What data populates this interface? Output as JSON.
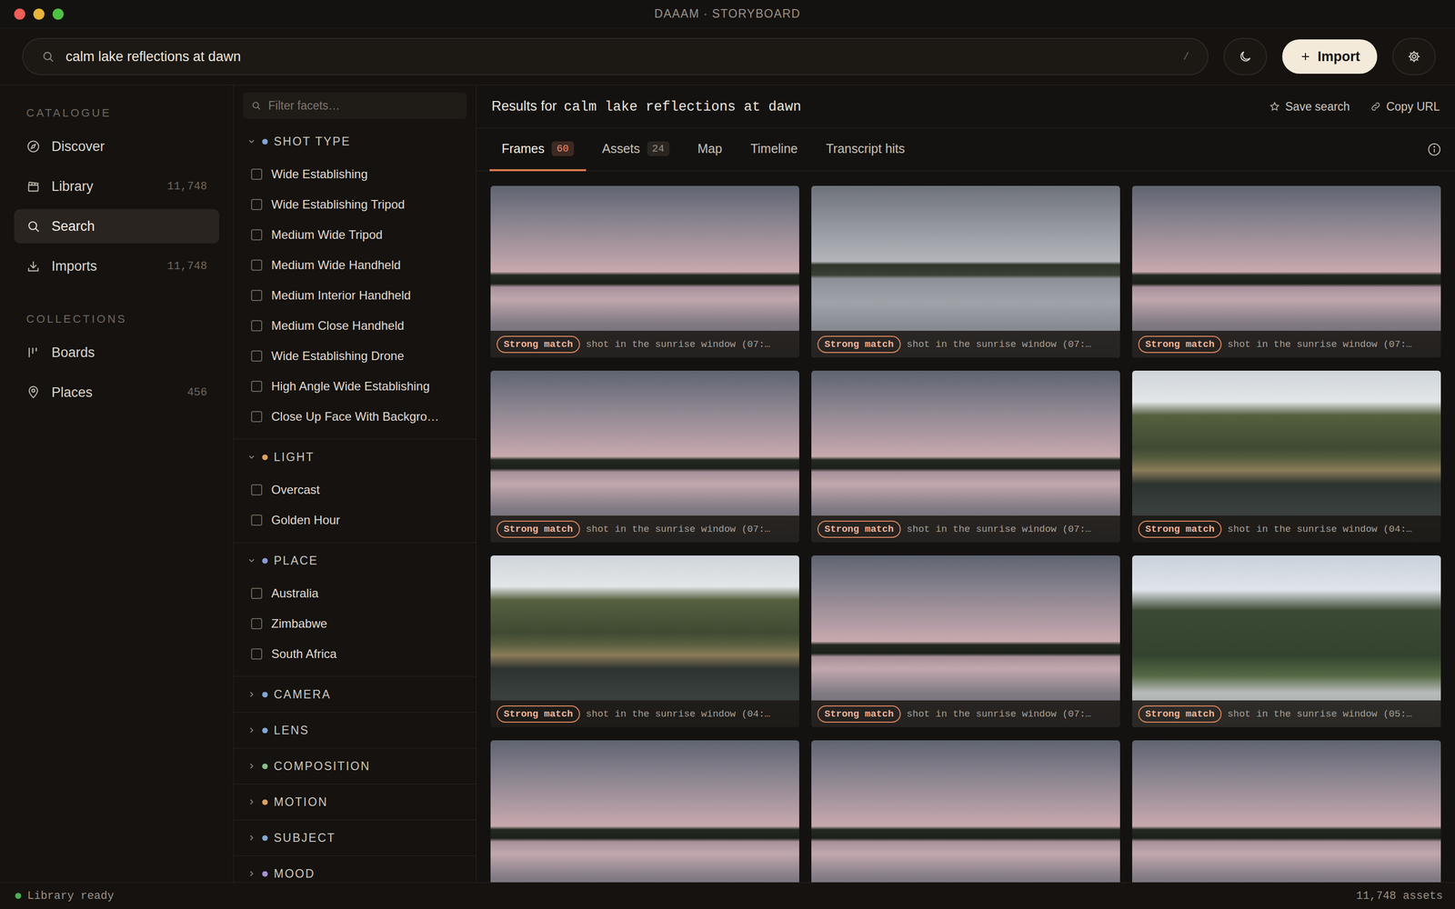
{
  "window": {
    "title": "DAAAM · STORYBOARD"
  },
  "search": {
    "value": "calm lake reflections at dawn",
    "shortcut": "/"
  },
  "toolbar": {
    "import": "Import"
  },
  "sidebar": {
    "sections": [
      {
        "label": "CATALOGUE",
        "items": [
          {
            "label": "Discover",
            "count": null,
            "selected": false
          },
          {
            "label": "Library",
            "count": "11,748",
            "selected": false
          },
          {
            "label": "Search",
            "count": null,
            "selected": true
          },
          {
            "label": "Imports",
            "count": "11,748",
            "selected": false
          }
        ]
      },
      {
        "label": "COLLECTIONS",
        "items": [
          {
            "label": "Boards",
            "count": null,
            "selected": false
          },
          {
            "label": "Places",
            "count": "456",
            "selected": false
          }
        ]
      }
    ]
  },
  "facets": {
    "filter_placeholder": "Filter facets…",
    "groups": [
      {
        "label": "SHOT TYPE",
        "color": "#7fa7d9",
        "expanded": true,
        "options": [
          {
            "label": "Wide Establishing",
            "checked": false
          },
          {
            "label": "Wide Establishing Tripod",
            "checked": false
          },
          {
            "label": "Medium Wide Tripod",
            "checked": false
          },
          {
            "label": "Medium Wide Handheld",
            "checked": false
          },
          {
            "label": "Medium Interior Handheld",
            "checked": false
          },
          {
            "label": "Medium Close Handheld",
            "checked": false
          },
          {
            "label": "Wide Establishing Drone",
            "checked": false
          },
          {
            "label": "High Angle Wide Establishing",
            "checked": false
          },
          {
            "label": "Close Up Face With Backgro…",
            "checked": false
          }
        ]
      },
      {
        "label": "LIGHT",
        "color": "#e0a060",
        "expanded": true,
        "options": [
          {
            "label": "Overcast",
            "checked": false
          },
          {
            "label": "Golden Hour",
            "checked": false
          }
        ]
      },
      {
        "label": "PLACE",
        "color": "#8a9ad8",
        "expanded": true,
        "options": [
          {
            "label": "Australia",
            "checked": false
          },
          {
            "label": "Zimbabwe",
            "checked": false
          },
          {
            "label": "South Africa",
            "checked": false
          }
        ]
      },
      {
        "label": "CAMERA",
        "color": "#7fa7d9",
        "expanded": false,
        "options": []
      },
      {
        "label": "LENS",
        "color": "#7fa7d9",
        "expanded": false,
        "options": []
      },
      {
        "label": "COMPOSITION",
        "color": "#86c08a",
        "expanded": false,
        "options": []
      },
      {
        "label": "MOTION",
        "color": "#e0a060",
        "expanded": false,
        "options": []
      },
      {
        "label": "SUBJECT",
        "color": "#7fa7d9",
        "expanded": false,
        "options": []
      },
      {
        "label": "MOOD",
        "color": "#a890d8",
        "expanded": false,
        "options": []
      }
    ]
  },
  "results": {
    "prefix": "Results for",
    "query": "calm lake reflections at dawn",
    "actions": [
      "Save search",
      "Copy URL"
    ]
  },
  "tabs": [
    {
      "label": "Frames",
      "count": "60",
      "selected": true
    },
    {
      "label": "Assets",
      "count": "24",
      "selected": false
    },
    {
      "label": "Map",
      "count": null,
      "selected": false
    },
    {
      "label": "Timeline",
      "count": null,
      "selected": false
    },
    {
      "label": "Transcript hits",
      "count": null,
      "selected": false
    }
  ],
  "frames": [
    {
      "kind": "dawn",
      "badge": "Strong match",
      "caption": "shot in the sunrise window (07:…"
    },
    {
      "kind": "grey",
      "badge": "Strong match",
      "caption": "shot in the sunrise window (07:…"
    },
    {
      "kind": "dawn",
      "badge": "Strong match",
      "caption": "shot in the sunrise window (07:…"
    },
    {
      "kind": "dawn",
      "badge": "Strong match",
      "caption": "shot in the sunrise window (07:…"
    },
    {
      "kind": "dawn",
      "badge": "Strong match",
      "caption": "shot in the sunrise window (07:…"
    },
    {
      "kind": "shore",
      "badge": "Strong match",
      "caption": "shot in the sunrise window (04:…"
    },
    {
      "kind": "shore",
      "badge": "Strong match",
      "caption": "shot in the sunrise window (04:…"
    },
    {
      "kind": "dawn",
      "badge": "Strong match",
      "caption": "shot in the sunrise window (07:…"
    },
    {
      "kind": "hills",
      "badge": "Strong match",
      "caption": "shot in the sunrise window (05:…"
    },
    {
      "kind": "dawn",
      "badge": null,
      "caption": null
    },
    {
      "kind": "dawn",
      "badge": null,
      "caption": null
    },
    {
      "kind": "dawn",
      "badge": null,
      "caption": null
    }
  ],
  "status_bar": {
    "left": "Library ready",
    "ready": true,
    "right": "11,748 assets"
  }
}
